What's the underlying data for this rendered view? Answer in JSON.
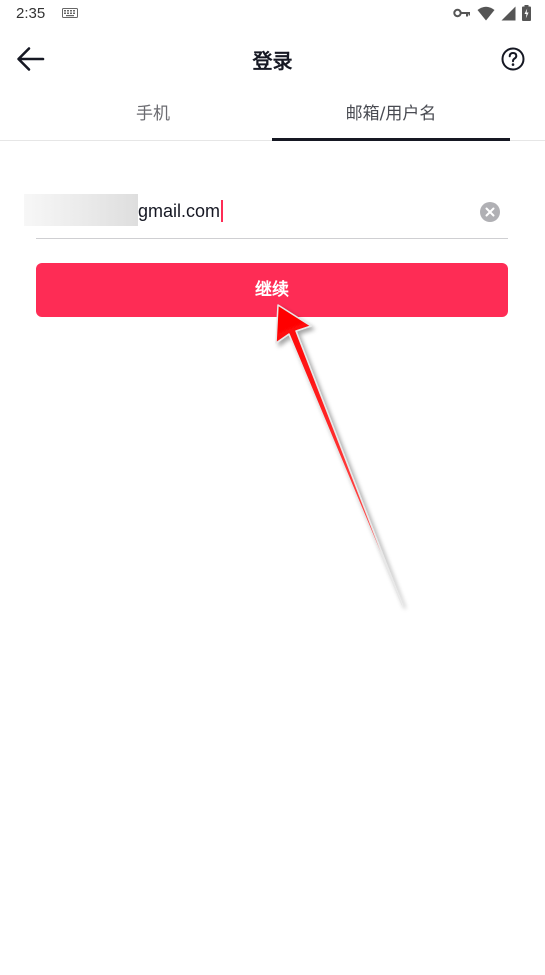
{
  "status_bar": {
    "time": "2:35",
    "icons": [
      "keyboard-icon",
      "vpn-key-icon",
      "wifi-icon",
      "signal-icon",
      "battery-charging-icon"
    ]
  },
  "header": {
    "title": "登录",
    "back_icon": "arrow-left-icon",
    "help_icon": "question-circle-icon"
  },
  "tabs": [
    {
      "label": "手机",
      "active": false
    },
    {
      "label": "邮箱/用户名",
      "active": true
    }
  ],
  "email_input": {
    "value": "gmail.com",
    "value_redacted": true,
    "clear_icon": "clear-circle-icon"
  },
  "continue_button": {
    "label": "继续"
  },
  "colors": {
    "accent": "#fe2c55",
    "text": "#161823",
    "annotation_arrow": "#ff0000"
  }
}
